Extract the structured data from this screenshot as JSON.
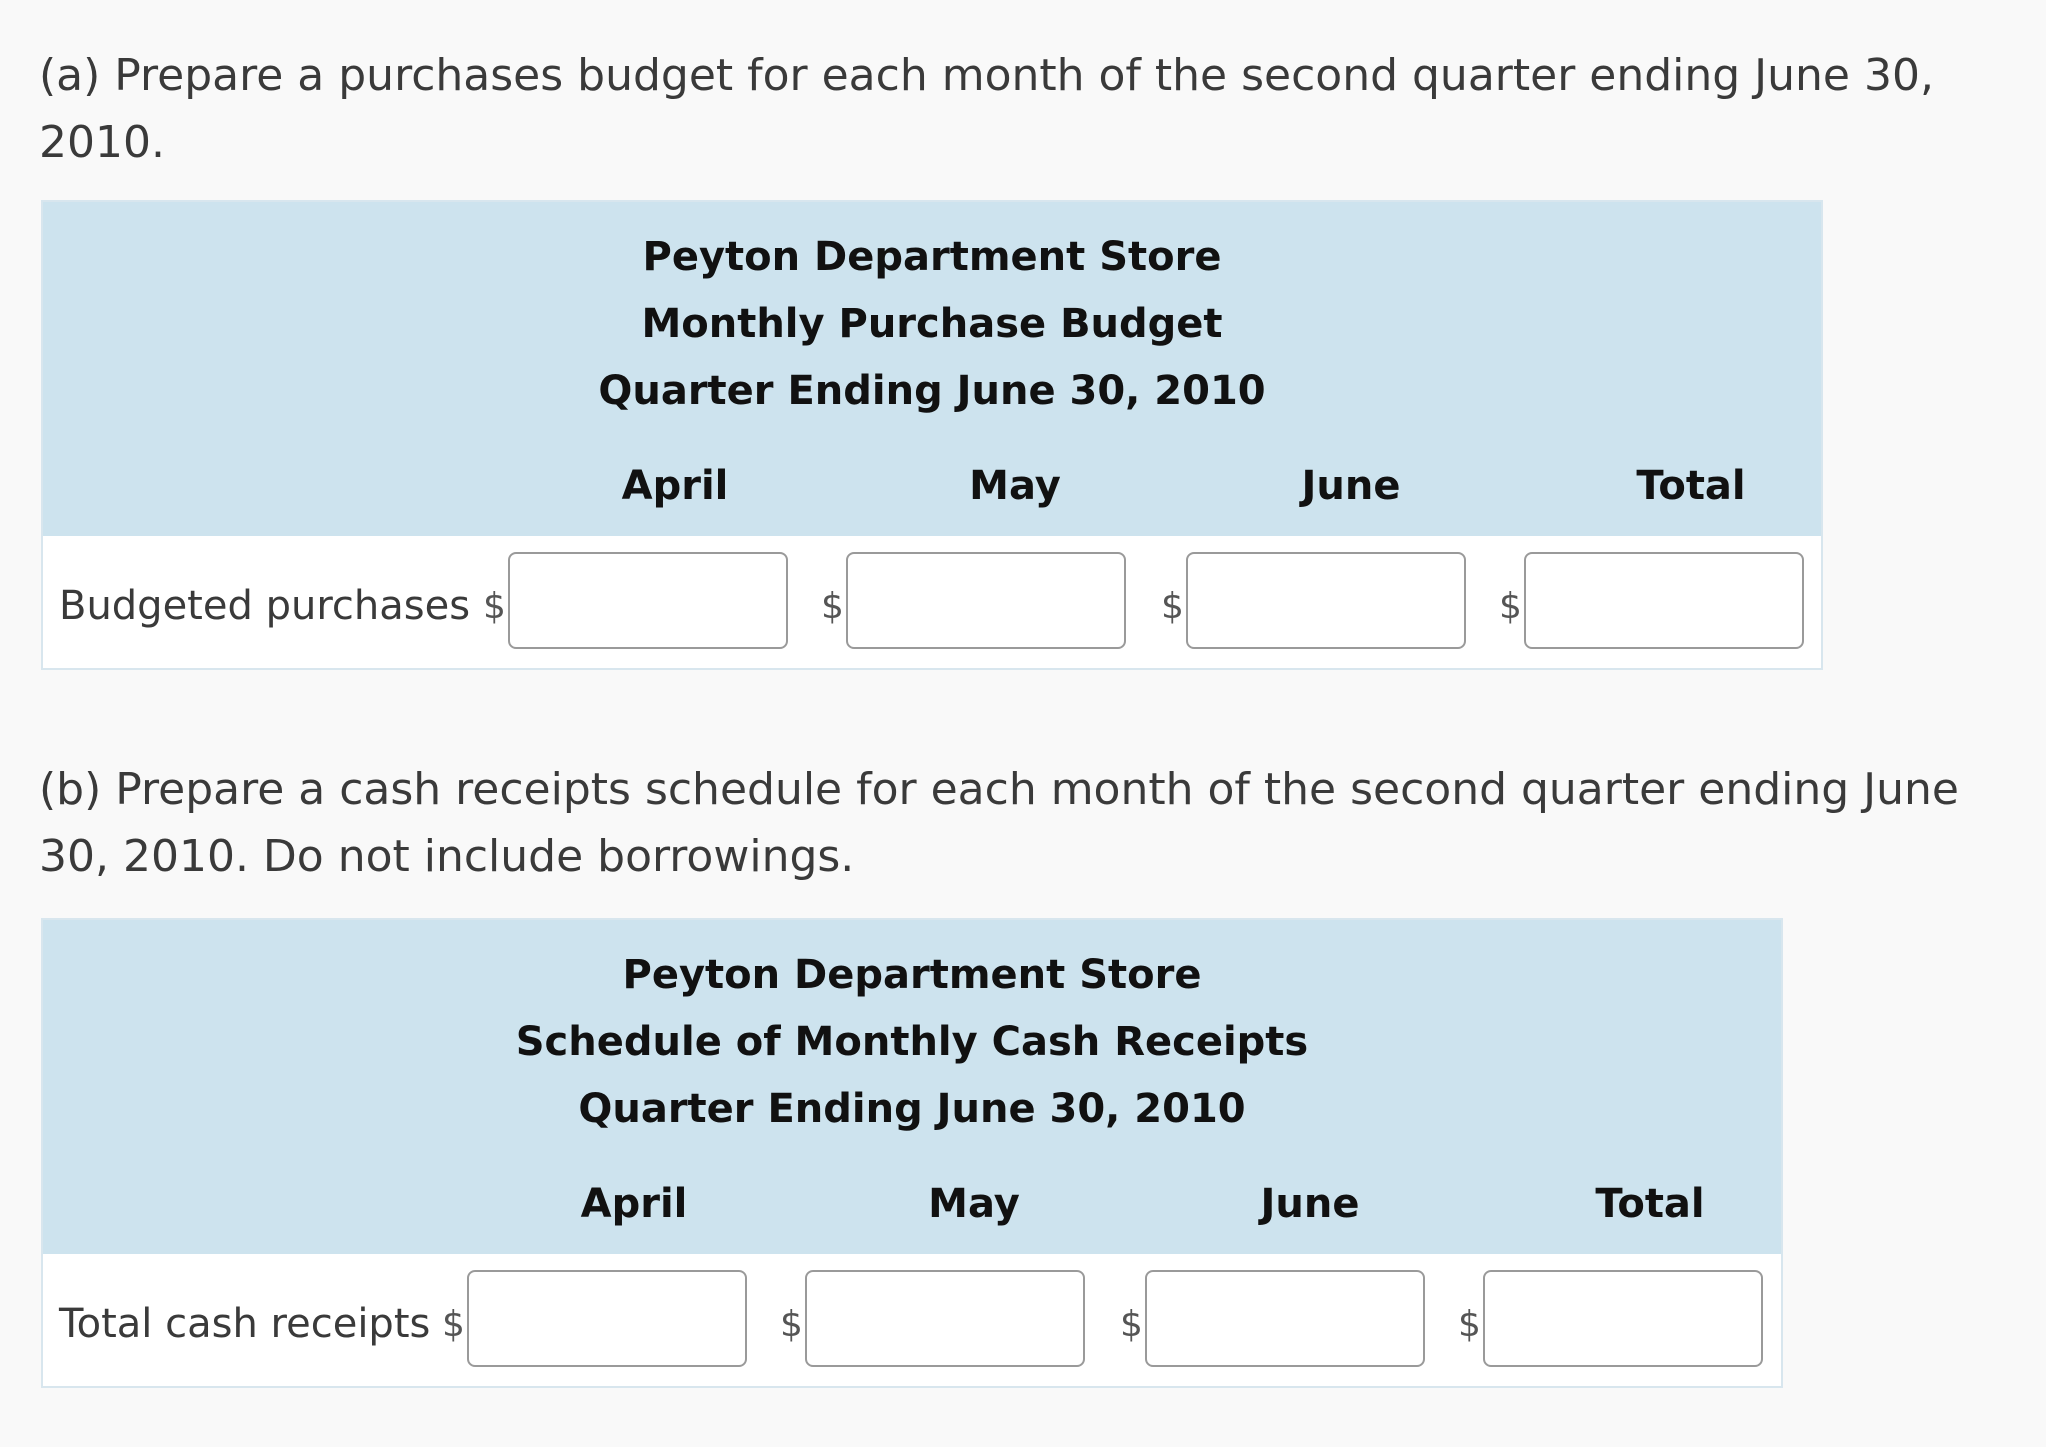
{
  "part_a": {
    "prompt": "(a) Prepare a purchases budget for each month of the second quarter ending June 30, 2010.",
    "company": "Peyton Department Store",
    "statement": "Monthly Purchase Budget",
    "period": "Quarter Ending June 30, 2010",
    "columns": [
      "April",
      "May",
      "June",
      "Total"
    ],
    "row_label": "Budgeted purchases",
    "currency": "$",
    "values": [
      "",
      "",
      "",
      ""
    ]
  },
  "part_b": {
    "prompt": "(b) Prepare a cash receipts schedule for each month of the second quarter ending June 30, 2010. Do not include borrowings.",
    "company": "Peyton Department Store",
    "statement": "Schedule of Monthly Cash Receipts",
    "period": "Quarter Ending June 30, 2010",
    "columns": [
      "April",
      "May",
      "June",
      "Total"
    ],
    "row_label": "Total cash receipts",
    "currency": "$",
    "values": [
      "",
      "",
      "",
      ""
    ]
  },
  "colors": {
    "page_background": "#f9f9f9",
    "header_background": "#cde3ee",
    "panel_border": "#d8e6ee",
    "input_border": "#9a9a9a"
  }
}
